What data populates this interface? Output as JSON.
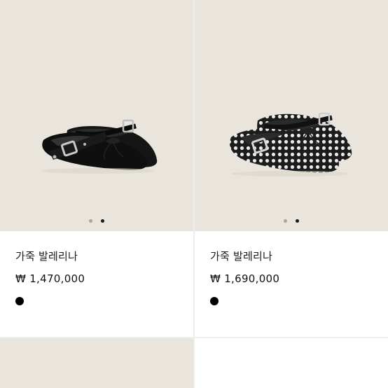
{
  "products": [
    {
      "name": "가죽 발레리나",
      "price": "₩ 1,470,000",
      "color": "#000000",
      "image_bg": "#e9e5dd",
      "image_icon": "leather-ballerina-shoe-image",
      "carousel": {
        "count": 2,
        "active_index": 1
      }
    },
    {
      "name": "가죽 발레리나",
      "price": "₩ 1,690,000",
      "color": "#000000",
      "image_bg": "#e9e5dd",
      "image_icon": "studded-ballerina-shoe-image",
      "carousel": {
        "count": 2,
        "active_index": 1
      }
    }
  ],
  "colors": {
    "image_background": "#e9e5dd",
    "dot_inactive": "#a9a59e",
    "dot_active": "#1a1a1a",
    "divider": "#eeeeee"
  }
}
